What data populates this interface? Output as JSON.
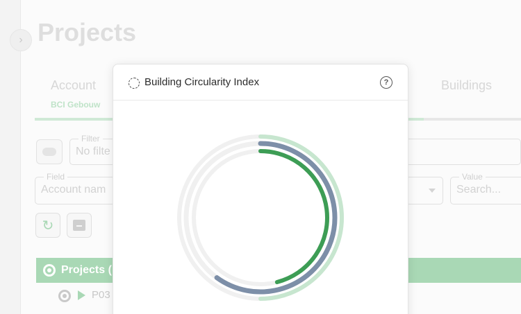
{
  "page": {
    "title": "Projects"
  },
  "tabs": [
    {
      "label": "Account",
      "sublabel": "BCI Gebouw"
    },
    {
      "label": "Buildings"
    }
  ],
  "filters": {
    "filter_legend": "Filter",
    "filter_value": "No filte",
    "field_legend": "Field",
    "field_value": "Account nam",
    "value_legend": "Value",
    "value_placeholder": "Search..."
  },
  "tree": {
    "header_label": "Projects (",
    "row_label": "P03"
  },
  "modal": {
    "title": "Building Circularity Index",
    "help_glyph": "?"
  },
  "chart_data": {
    "type": "radial-progress",
    "title": "",
    "series": [
      {
        "value": 0.5,
        "color": "#c7e6cf"
      },
      {
        "value": 0.6,
        "color": "#7d8fa8"
      },
      {
        "value": 0.46,
        "color": "#3d9d55"
      }
    ],
    "track_color": "#f0f0f0"
  },
  "colors": {
    "accent": "#a9d8b5",
    "green": "#3d9d55",
    "slate": "#7d8fa8"
  }
}
